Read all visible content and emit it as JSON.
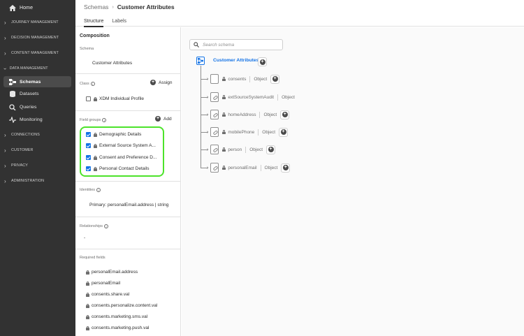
{
  "nav": {
    "home": "Home",
    "sections": {
      "journey": "JOURNEY MANAGEMENT",
      "decision": "DECISION MANAGEMENT",
      "content": "CONTENT MANAGEMENT",
      "data": "DATA MANAGEMENT",
      "connections": "CONNECTIONS",
      "customer": "CUSTOMER",
      "privacy": "PRIVACY",
      "administration": "ADMINISTRATION"
    },
    "items": {
      "schemas": "Schemas",
      "datasets": "Datasets",
      "queries": "Queries",
      "monitoring": "Monitoring"
    }
  },
  "header": {
    "breadcrumb_parent": "Schemas",
    "breadcrumb_current": "Customer Attributes",
    "tabs": {
      "structure": "Structure",
      "labels": "Labels"
    }
  },
  "composition": {
    "title": "Composition",
    "schema_label": "Schema",
    "schema_value": "Customer Attributes",
    "class_label": "Class",
    "class_value": "XDM Individual Profile",
    "assign_label": "Assign",
    "field_groups_label": "Field groups",
    "add_label": "Add",
    "field_groups": {
      "g1": "Demographic Details",
      "g2": "External Source System A...",
      "g3": "Consent and Preference D...",
      "g4": "Personal Contact Details"
    },
    "identities_label": "Identities",
    "identities_value": "Primary: personalEmail.address | string",
    "relationships_label": "Relationships",
    "relationships_value": "-",
    "required_label": "Required fields",
    "required": {
      "r1": "personalEmail.address",
      "r2": "personalEmail",
      "r3": "consents.share.val",
      "r4": "consents.personalize.content.val",
      "r5": "consents.marketing.sms.val",
      "r6": "consents.marketing.push.val"
    }
  },
  "canvas": {
    "search_placeholder": "Search schema",
    "root_label": "Customer Attributes",
    "nodes": {
      "n1": {
        "name": "consents",
        "type": "Object"
      },
      "n2": {
        "name": "extSourceSystemAudit",
        "type": "Object"
      },
      "n3": {
        "name": "homeAddress",
        "type": "Object"
      },
      "n4": {
        "name": "mobilePhone",
        "type": "Object"
      },
      "n5": {
        "name": "person",
        "type": "Object"
      },
      "n6": {
        "name": "personalEmail",
        "type": "Object"
      }
    }
  },
  "colors": {
    "nav_bg": "#323232",
    "accent_blue": "#1473e6",
    "highlight_green": "#4ce32a"
  }
}
